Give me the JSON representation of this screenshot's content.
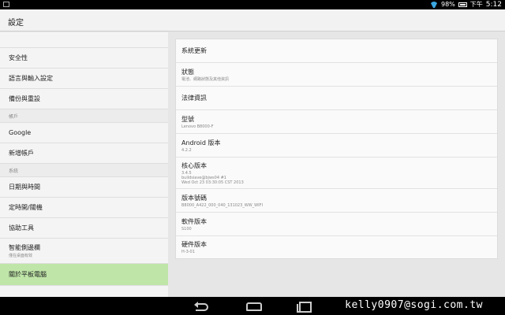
{
  "status_bar": {
    "battery": "98%",
    "ampm": "下午",
    "time": "5:12"
  },
  "action_bar": {
    "title": "設定"
  },
  "left_pane": {
    "items_top": [
      {
        "label": "安全性"
      },
      {
        "label": "語言與輸入設定"
      },
      {
        "label": "備份與重設"
      }
    ],
    "header_accounts": "帳戶",
    "items_accounts": [
      {
        "label": "Google"
      },
      {
        "label": "新增帳戶"
      }
    ],
    "header_system": "系統",
    "items_system": [
      {
        "label": "日期與時間"
      },
      {
        "label": "定時開/關機"
      },
      {
        "label": "協助工具"
      }
    ],
    "smart_sidebar": {
      "label": "智能側邊欄",
      "sub": "僅在桌面有效"
    },
    "selected_item": {
      "label": "關於平板電腦"
    }
  },
  "about": {
    "system_update": "系統更新",
    "status": {
      "title": "狀態",
      "sub": "電池、網路狀態及其他資訊"
    },
    "legal": "法律資訊",
    "model": {
      "title": "型號",
      "sub": "Lenovo B8000-F"
    },
    "android": {
      "title": "Android 版本",
      "sub": "4.2.2"
    },
    "kernel": {
      "title": "核心版本",
      "line1": "3.4.5",
      "line2": "buildsiave@bjws04 #1",
      "line3": "Wed Oct 23 03:30:05 CST 2013"
    },
    "build": {
      "title": "版本號碼",
      "sub": "B8000_A422_000_040_131023_WW_WIFI"
    },
    "software": {
      "title": "軟件版本",
      "sub": "S100"
    },
    "hardware": {
      "title": "硬件版本",
      "sub": "H-3-01"
    }
  },
  "watermark": "kelly0907@sogi.com.tw"
}
